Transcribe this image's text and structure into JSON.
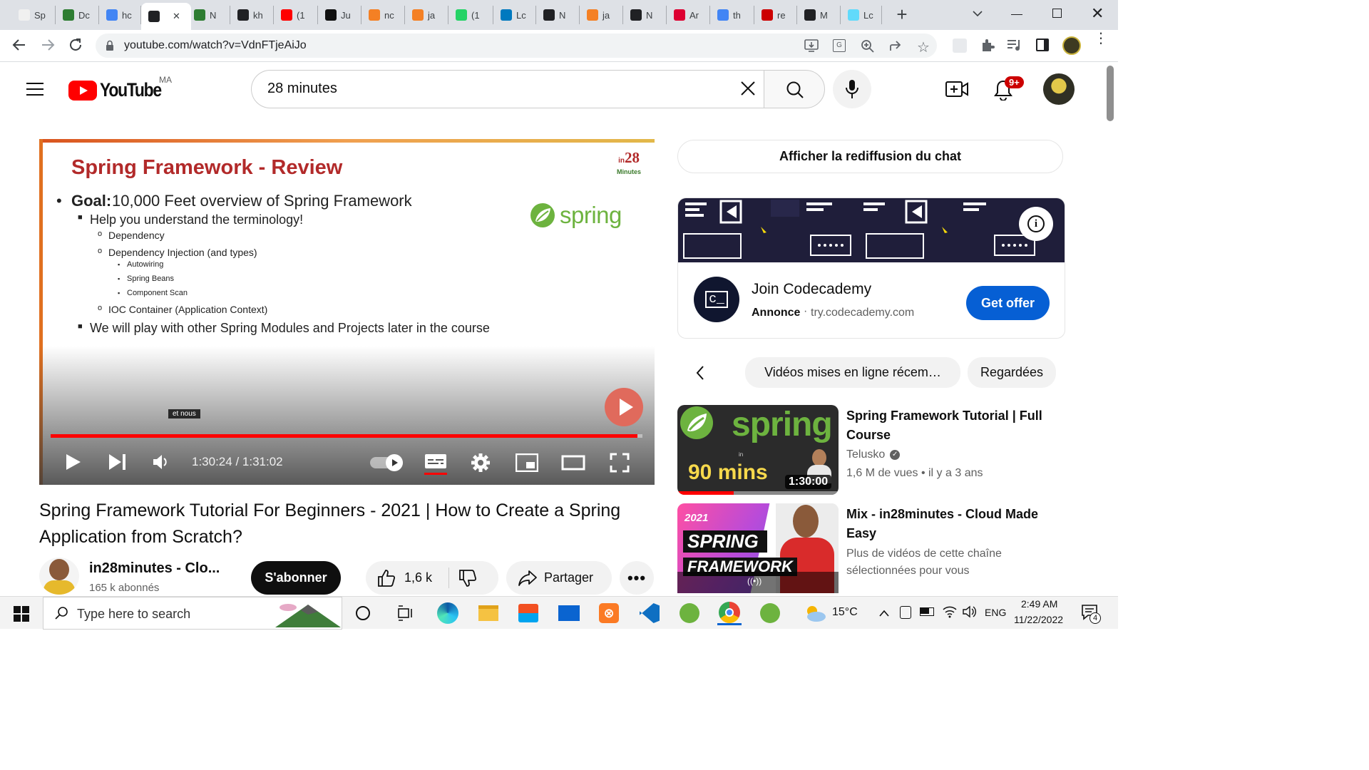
{
  "browser": {
    "tabs": [
      {
        "title": "Sp",
        "icon": "in28minutes-favicon",
        "color": "#f0f0f0"
      },
      {
        "title": "Dc",
        "icon": "hexagon-favicon",
        "color": "#2e7d32"
      },
      {
        "title": "hc",
        "icon": "google-icon",
        "color": "#4285f4"
      },
      {
        "title": "",
        "icon": "speaker-icon",
        "color": "#202124"
      },
      {
        "title": "N",
        "icon": "hexagon-favicon",
        "color": "#2e7d32"
      },
      {
        "title": "kh",
        "icon": "github-icon",
        "color": "#202124"
      },
      {
        "title": "(1",
        "icon": "youtube-icon",
        "color": "#ff0000"
      },
      {
        "title": "Ju",
        "icon": "hn-icon",
        "color": "#111111"
      },
      {
        "title": "nc",
        "icon": "stackoverflow-icon",
        "color": "#f48024"
      },
      {
        "title": "ja",
        "icon": "stackoverflow-icon",
        "color": "#f48024"
      },
      {
        "title": "(1",
        "icon": "whatsapp-icon",
        "color": "#25d366"
      },
      {
        "title": "Lc",
        "icon": "trello-icon",
        "color": "#0079bf"
      },
      {
        "title": "N",
        "icon": "chrome-icon",
        "color": "#202124"
      },
      {
        "title": "ja",
        "icon": "stackoverflow-icon",
        "color": "#f48024"
      },
      {
        "title": "N",
        "icon": "chrome-icon",
        "color": "#202124"
      },
      {
        "title": "Ar",
        "icon": "angular-icon",
        "color": "#dd0031"
      },
      {
        "title": "th",
        "icon": "google-icon",
        "color": "#4285f4"
      },
      {
        "title": "re",
        "icon": "n-icon",
        "color": "#cc0000"
      },
      {
        "title": "M",
        "icon": "github-icon",
        "color": "#202124"
      },
      {
        "title": "Lc",
        "icon": "react-icon",
        "color": "#61dafb"
      }
    ],
    "url": "youtube.com/watch?v=VdnFTjeAiJo"
  },
  "youtube": {
    "logo_text": "YouTube",
    "country_code": "MA",
    "search_value": "28 minutes",
    "notifications_badge": "9+"
  },
  "video": {
    "slide": {
      "title": "Spring Framework - Review",
      "goal_label": "Goal:",
      "goal_text": "10,000 Feet overview of Spring Framework",
      "point1": "Help you understand the terminology!",
      "sub1": "Dependency",
      "sub2": "Dependency Injection (and types)",
      "sub2a": "Autowiring",
      "sub2b": "Spring Beans",
      "sub2c": "Component Scan",
      "sub3": "IOC Container (Application Context)",
      "point2": "We will play with other Spring Modules and Projects later in the course",
      "logo_number": "28",
      "logo_prefix": "in",
      "logo_sub": "Minutes",
      "spring_word": "spring"
    },
    "caption": "et nous",
    "time_current": "1:30:24",
    "time_sep": " / ",
    "time_total": "1:31:02",
    "progress_fraction": 0.992,
    "title": "Spring Framework Tutorial For Beginners - 2021 | How to Create a Spring Application from Scratch?",
    "channel_name": "in28minutes - Clo...",
    "subscribers": "165 k abonnés",
    "subscribe_label": "S'abonner",
    "likes": "1,6 k",
    "share_label": "Partager"
  },
  "sidebar": {
    "chat_replay_label": "Afficher la rediffusion du chat",
    "ad": {
      "title": "Join Codecademy",
      "label": "Annonce",
      "domain": "try.codecademy.com",
      "cta": "Get offer",
      "logo_text": "c_"
    },
    "chips": [
      "Vidéos mises en ligne récem…",
      "Regardées"
    ],
    "videos": [
      {
        "title": "Spring Framework Tutorial | Full Course",
        "channel": "Telusko",
        "views": "1,6 M de vues",
        "age": "il y a 3 ans",
        "duration": "1:30:00",
        "thumb_spring": "spring",
        "thumb_in": "in",
        "thumb_mins": "90 mins",
        "watched_fraction": 0.35
      },
      {
        "title": "Mix - in28minutes - Cloud Made Easy",
        "subtitle": "Plus de vidéos de cette chaîne sélectionnées pour vous",
        "thumb_year": "2021",
        "thumb_spring": "SPRING",
        "thumb_framework": "FRAMEWORK",
        "thumb_live": "((•))"
      }
    ]
  },
  "taskbar": {
    "search_placeholder": "Type here to search",
    "weather": "15°C",
    "lang": "ENG",
    "time": "2:49 AM",
    "date": "11/22/2022",
    "notification_count": "4"
  }
}
